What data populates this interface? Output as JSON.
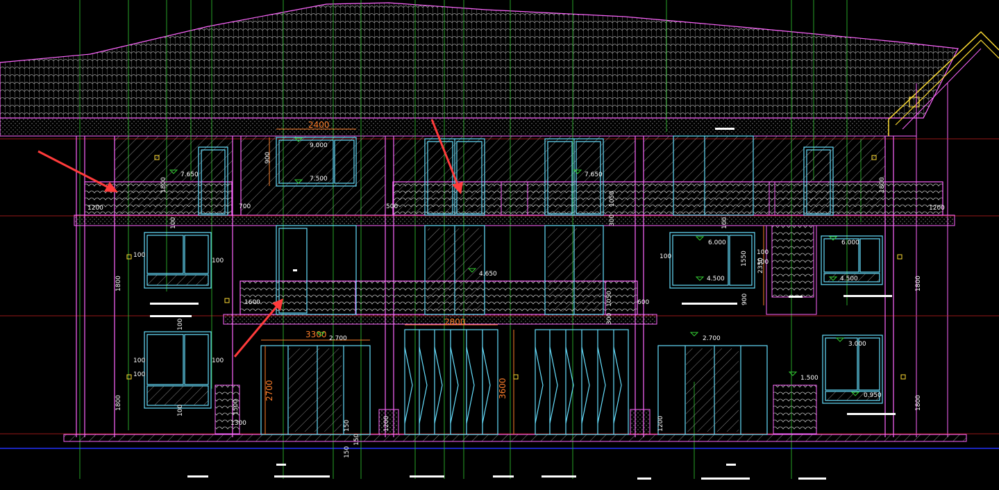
{
  "colors": {
    "background": "#000000",
    "wall": "#ff66ff",
    "window": "#66e0ff",
    "leader": "#33cc33",
    "hatch": "#bbbbbb",
    "grid_red": "#cc2222",
    "grid_blue": "#2233ff",
    "dimension_orange": "#ff7f2a",
    "arrow_red": "#ff3b3b",
    "roof_yellow": "#ffdd33"
  },
  "elevation_marks": [
    {
      "id": "e9000",
      "text": "9.000"
    },
    {
      "id": "e7500",
      "text": "7.500"
    },
    {
      "id": "e7650a",
      "text": "7.650"
    },
    {
      "id": "e7650b",
      "text": "7.650"
    },
    {
      "id": "e6000a",
      "text": "6.000"
    },
    {
      "id": "e6000b",
      "text": "6.000"
    },
    {
      "id": "e4650",
      "text": "4.650"
    },
    {
      "id": "e4500a",
      "text": "4.500"
    },
    {
      "id": "e4500b",
      "text": "4.500"
    },
    {
      "id": "e2700a",
      "text": "2.700"
    },
    {
      "id": "e2700b",
      "text": "2.700"
    },
    {
      "id": "e3000",
      "text": "3.000"
    },
    {
      "id": "e1500",
      "text": "1.500"
    },
    {
      "id": "e0950",
      "text": "0.950"
    }
  ],
  "dimensions": [
    {
      "id": "d2400",
      "text": "2400"
    },
    {
      "id": "d3300",
      "text": "3300"
    },
    {
      "id": "d2800",
      "text": "2800"
    },
    {
      "id": "d3600",
      "text": "3600"
    },
    {
      "id": "d2700",
      "text": "2700"
    },
    {
      "id": "d1200a",
      "text": "1200"
    },
    {
      "id": "d1200b",
      "text": "1200"
    },
    {
      "id": "d700",
      "text": "700"
    },
    {
      "id": "d500",
      "text": "500"
    },
    {
      "id": "d1600",
      "text": "1600"
    },
    {
      "id": "d600",
      "text": "600"
    },
    {
      "id": "d1800a",
      "text": "1800"
    },
    {
      "id": "d1800b",
      "text": "1800"
    },
    {
      "id": "d1800c",
      "text": "1800"
    },
    {
      "id": "d1800d",
      "text": "1800"
    },
    {
      "id": "d1800e",
      "text": "1800"
    },
    {
      "id": "d1800f",
      "text": "1800"
    },
    {
      "id": "d1050a",
      "text": "1050"
    },
    {
      "id": "d1050b",
      "text": "1050"
    },
    {
      "id": "d1550",
      "text": "1550"
    },
    {
      "id": "d2350",
      "text": "2350"
    },
    {
      "id": "d1500v",
      "text": "1500"
    },
    {
      "id": "d1200v",
      "text": "1200"
    },
    {
      "id": "d1300",
      "text": "1300"
    },
    {
      "id": "d900",
      "text": "900"
    },
    {
      "id": "d300a",
      "text": "300"
    },
    {
      "id": "d300b",
      "text": "300"
    },
    {
      "id": "d150a",
      "text": "150"
    },
    {
      "id": "d150b",
      "text": "150"
    },
    {
      "id": "d150c",
      "text": "150"
    },
    {
      "id": "d100a",
      "text": "100"
    },
    {
      "id": "d100b",
      "text": "100"
    },
    {
      "id": "d100c",
      "text": "100"
    },
    {
      "id": "d100d",
      "text": "100"
    },
    {
      "id": "d100e",
      "text": "100"
    },
    {
      "id": "d100f",
      "text": "100"
    },
    {
      "id": "d100g",
      "text": "100"
    },
    {
      "id": "d100h",
      "text": "100"
    },
    {
      "id": "d100i",
      "text": "100"
    },
    {
      "id": "d100j",
      "text": "100"
    },
    {
      "id": "d100k",
      "text": "100"
    },
    {
      "id": "d100l",
      "text": "100"
    },
    {
      "id": "d900w",
      "text": "900"
    },
    {
      "id": "d1200w",
      "text": "1200"
    }
  ]
}
